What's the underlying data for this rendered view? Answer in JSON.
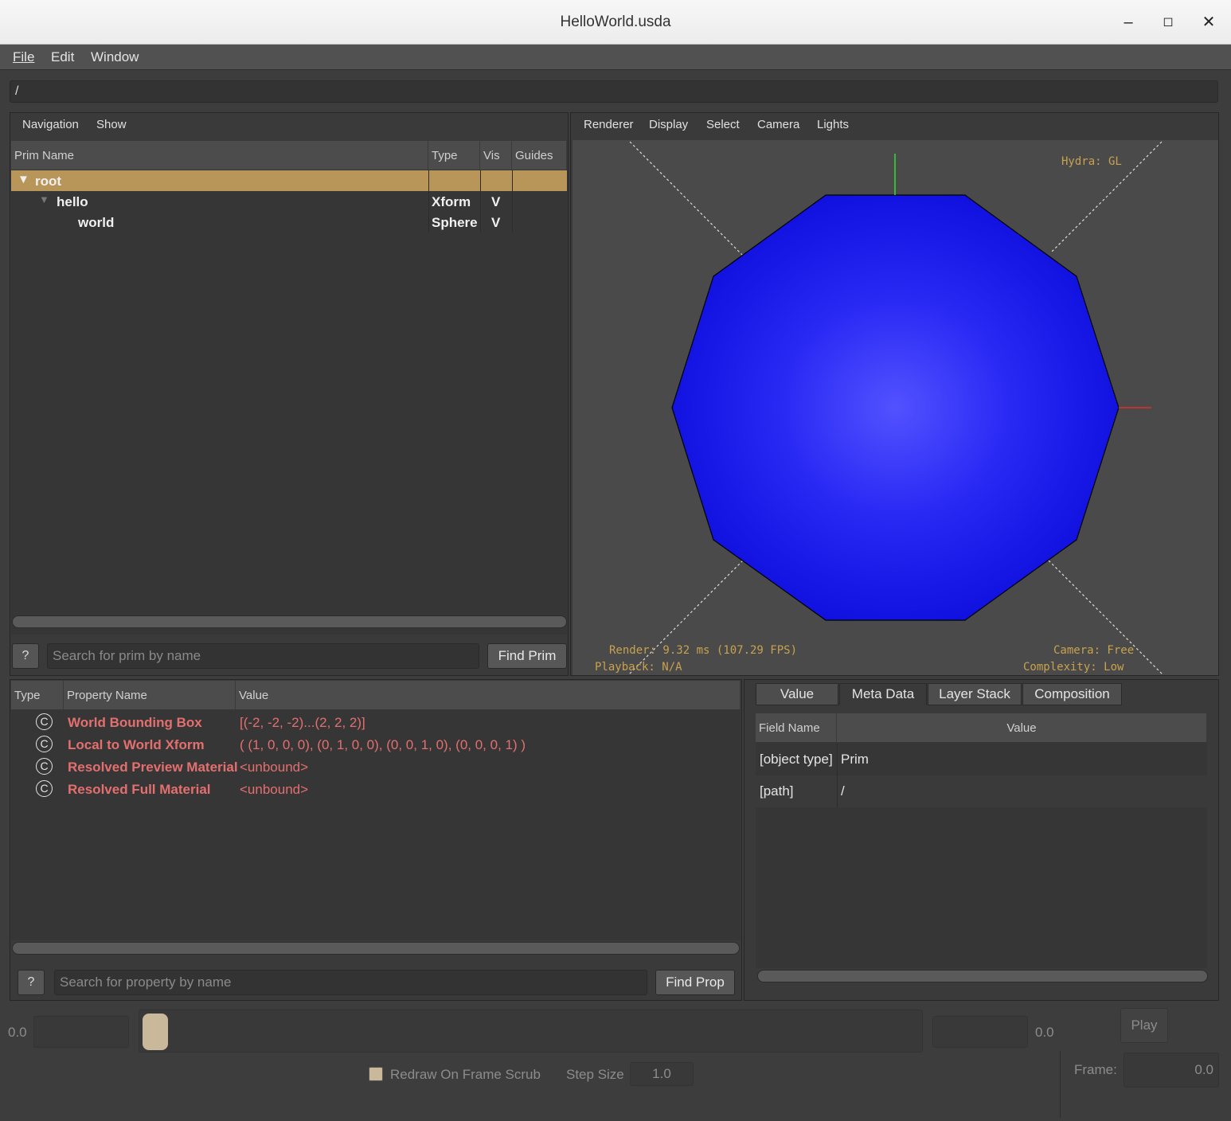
{
  "window": {
    "title": "HelloWorld.usda"
  },
  "menu": [
    "File",
    "Edit",
    "Window"
  ],
  "path_bar": {
    "value": "/"
  },
  "prim_panel": {
    "menu": [
      "Navigation",
      "Show"
    ],
    "columns": [
      "Prim Name",
      "Type",
      "Vis",
      "Guides"
    ],
    "rows": [
      {
        "name": "root",
        "type": "",
        "vis": ""
      },
      {
        "name": "hello",
        "type": "Xform",
        "vis": "V"
      },
      {
        "name": "world",
        "type": "Sphere",
        "vis": "V"
      }
    ],
    "help_label": "?",
    "search_placeholder": "Search for prim by name",
    "find_label": "Find Prim"
  },
  "viewport": {
    "menu": [
      "Renderer",
      "Display",
      "Select",
      "Camera",
      "Lights"
    ],
    "hud": {
      "renderer": "Hydra: GL",
      "render_time": "Render: 9.32 ms (107.29 FPS)",
      "playback": "Playback: N/A",
      "camera": "Camera: Free",
      "complexity": "Complexity: Low"
    },
    "colors": {
      "sphere": "#1a1aff",
      "background": "#4a4a4a",
      "x_axis": "#e03030",
      "y_axis": "#30e030"
    }
  },
  "property_panel": {
    "columns": [
      "Type",
      "Property Name",
      "Value"
    ],
    "rows": [
      {
        "type_icon": "C",
        "name": "World Bounding Box",
        "value": "[(-2, -2, -2)...(2, 2, 2)]"
      },
      {
        "type_icon": "C",
        "name": "Local to World Xform",
        "value": "( (1, 0, 0, 0), (0, 1, 0, 0), (0, 0, 1, 0), (0, 0, 0, 1) )"
      },
      {
        "type_icon": "C",
        "name": "Resolved Preview Material",
        "value": "<unbound>"
      },
      {
        "type_icon": "C",
        "name": "Resolved Full Material",
        "value": "<unbound>"
      }
    ],
    "help_label": "?",
    "search_placeholder": "Search for property by name",
    "find_label": "Find Prop"
  },
  "meta_panel": {
    "tabs": [
      "Value",
      "Meta Data",
      "Layer Stack",
      "Composition"
    ],
    "active_tab": "Meta Data",
    "columns": [
      "Field Name",
      "Value"
    ],
    "rows": [
      {
        "field": "[object type]",
        "value": "Prim"
      },
      {
        "field": "[path]",
        "value": "/"
      }
    ]
  },
  "timeline": {
    "start_label": "0.0",
    "end_label": "0.0",
    "redraw_label": "Redraw On Frame Scrub",
    "step_size_label": "Step Size",
    "step_size_value": "1.0",
    "play_label": "Play",
    "frame_label": "Frame:",
    "frame_value": "0.0"
  }
}
